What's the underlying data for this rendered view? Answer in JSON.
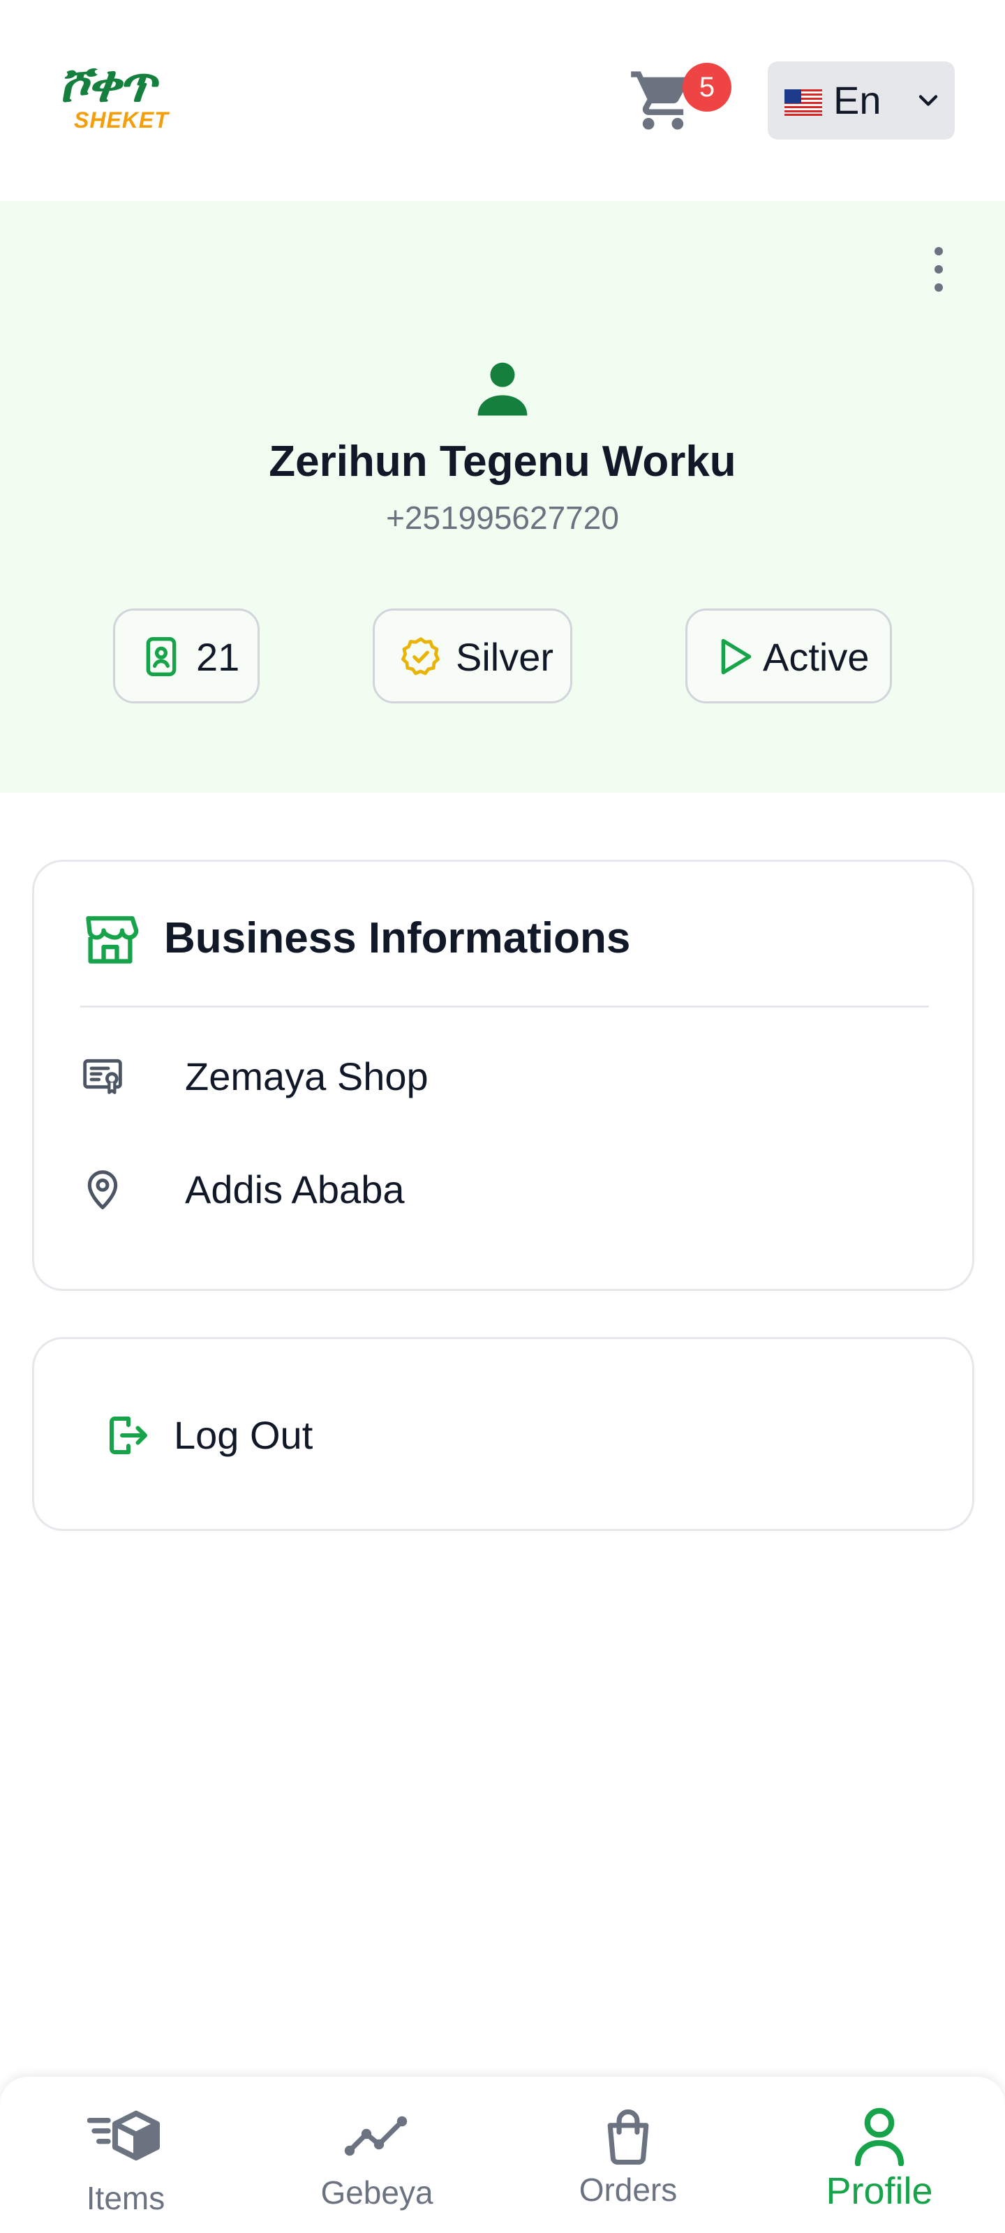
{
  "header": {
    "logo_amharic": "ሾቀጥ",
    "logo_latin": "SHEKET",
    "cart_count": "5",
    "language_label": "En"
  },
  "profile": {
    "name": "Zerihun Tegenu Worku",
    "phone": "+251995627720",
    "stats": {
      "count": "21",
      "tier": "Silver",
      "status": "Active"
    }
  },
  "business": {
    "title": "Business Informations",
    "shop_name": "Zemaya Shop",
    "city": "Addis Ababa"
  },
  "logout": {
    "label": "Log Out"
  },
  "bottom_nav": {
    "items": [
      "Items",
      "Gebeya",
      "Orders",
      "Profile"
    ],
    "active": "Profile"
  },
  "colors": {
    "brand_green": "#15803d",
    "accent_green": "#16a34a",
    "brand_orange": "#f59e0b",
    "badge_red": "#ef4444",
    "banner_bg": "#f0fdf0",
    "tier_gold": "#eab308"
  },
  "icons": {
    "cart": "shopping-cart-icon",
    "flag": "us-flag-icon",
    "menu": "more-vertical-icon",
    "avatar": "user-icon",
    "count": "id-badge-icon",
    "tier": "verified-badge-icon",
    "status": "play-icon",
    "business": "store-icon",
    "shop": "certificate-icon",
    "city": "map-pin-icon",
    "logout": "logout-icon"
  }
}
